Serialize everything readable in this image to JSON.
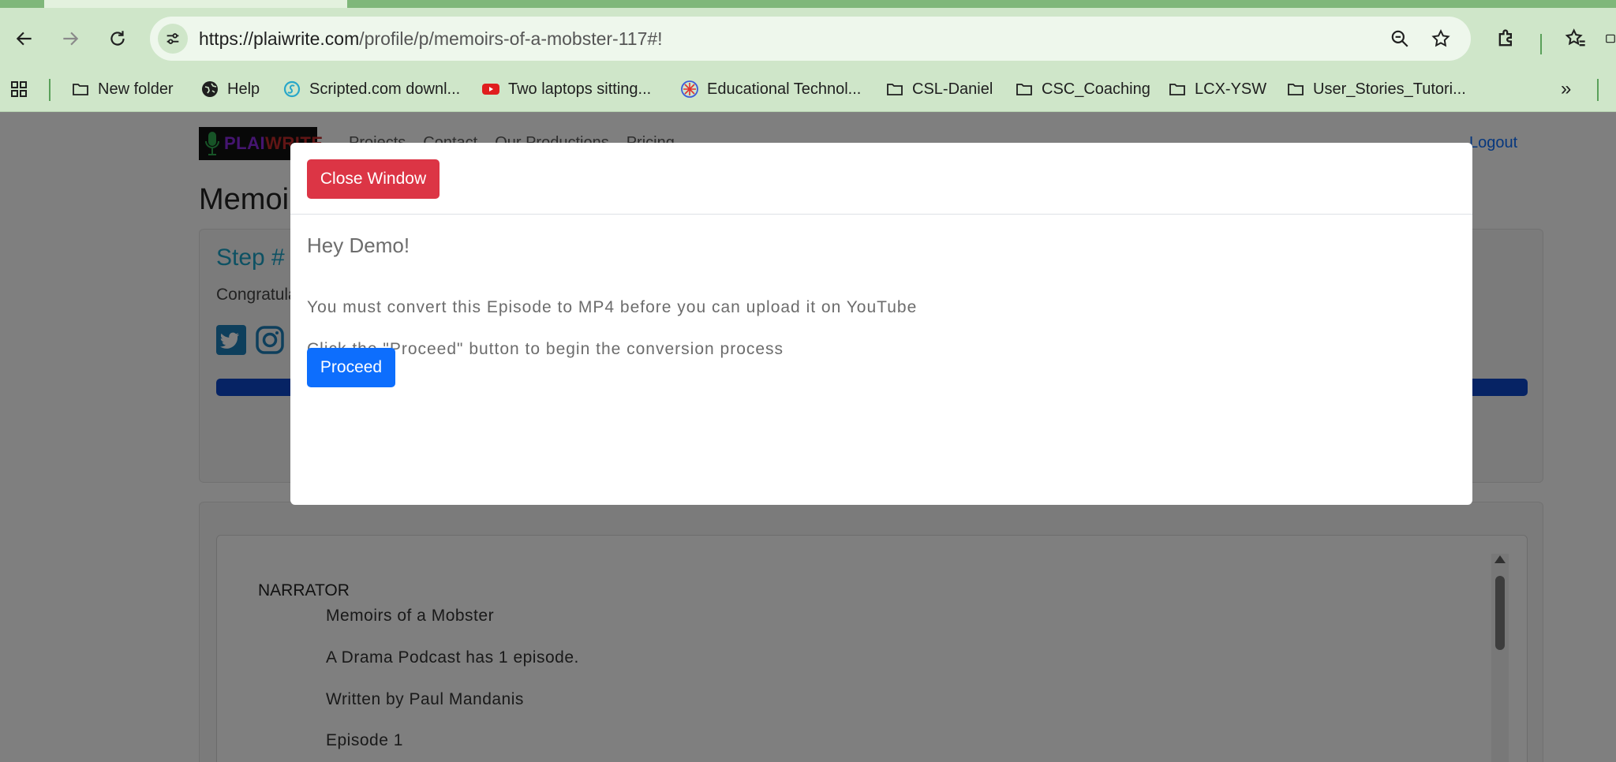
{
  "browser": {
    "url_host": "https://plaiwrite.com",
    "url_path": "/profile/p/memoirs-of-a-mobster-117#!",
    "bookmarks": [
      {
        "label": "New folder",
        "icon": "folder-icon"
      },
      {
        "label": "Help",
        "icon": "globe-icon"
      },
      {
        "label": "Scripted.com downl...",
        "icon": "scripted-icon"
      },
      {
        "label": "Two laptops sitting...",
        "icon": "youtube-icon"
      },
      {
        "label": "Educational Technol...",
        "icon": "edtech-icon"
      },
      {
        "label": "CSL-Daniel",
        "icon": "folder-icon"
      },
      {
        "label": "CSC_Coaching",
        "icon": "folder-icon"
      },
      {
        "label": "LCX-YSW",
        "icon": "folder-icon"
      },
      {
        "label": "User_Stories_Tutori...",
        "icon": "folder-icon"
      }
    ],
    "overflow_label": "»"
  },
  "site": {
    "logo_prefix": "PLAI",
    "logo_suffix": "WRITE",
    "nav": [
      "Projects",
      "Contact",
      "Our Productions",
      "Pricing"
    ],
    "logout": "Logout",
    "page_title": "Memoirs of a Mobster",
    "step_title": "Step #",
    "congrats": "Congratulations",
    "progress_fraction": 1.0
  },
  "script": {
    "speaker": "NARRATOR",
    "lines": [
      "Memoirs of a Mobster",
      "A Drama Podcast has 1 episode.",
      "Written by Paul Mandanis",
      "Episode 1"
    ]
  },
  "modal": {
    "close_label": "Close Window",
    "greeting": "Hey Demo!",
    "message_1": "You must convert this Episode to MP4 before you can upload it on YouTube",
    "message_2": "Click the \"Proceed\" button to begin the conversion process",
    "proceed_label": "Proceed"
  },
  "colors": {
    "chrome": "#cfe6c9",
    "danger": "#dc3545",
    "primary": "#0d6efd",
    "step_title": "#1ba3c6",
    "progress": "#0d47c8"
  }
}
